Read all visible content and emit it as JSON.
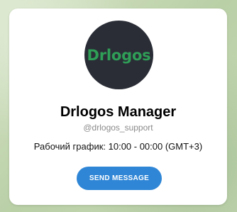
{
  "profile": {
    "avatar_text": "Drlogos",
    "name": "Drlogos Manager",
    "username": "@drlogos_support",
    "bio": "Рабочий график: 10:00 - 00:00 (GMT+3)"
  },
  "actions": {
    "send_label": "SEND MESSAGE"
  },
  "colors": {
    "button": "#2f86d6",
    "avatar_bg": "#2a2d36",
    "avatar_text": "#2f9e57",
    "card_bg": "#ffffff"
  }
}
